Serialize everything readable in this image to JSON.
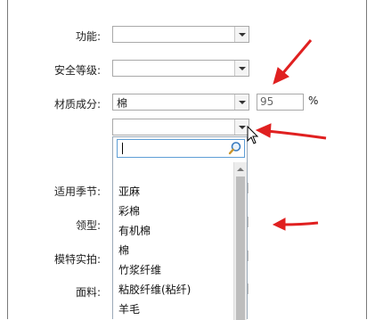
{
  "form": {
    "function_label": "功能:",
    "security_label": "安全等级:",
    "material_label": "材质成分:",
    "material_value": "棉",
    "percent_value": "95",
    "percent_unit": "%",
    "season_label": "适用季节:",
    "collar_label": "领型:",
    "model_label": "模特实拍:",
    "fabric_label": "面料:"
  },
  "dropdown": {
    "search_value": "",
    "options": [
      "亚麻",
      "彩棉",
      "有机棉",
      "棉",
      "竹浆纤维",
      "粘胶纤维(粘纤)",
      "羊毛"
    ]
  },
  "colors": {
    "annotation_arrow": "#e02020",
    "focus_border": "#5e9ed6"
  },
  "icons": {
    "search": "magnifier-icon",
    "cursor": "mouse-pointer-icon"
  }
}
